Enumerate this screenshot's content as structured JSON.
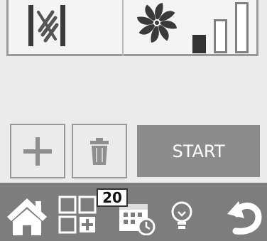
{
  "start_button": {
    "label": "START"
  },
  "schedule_badge": {
    "count": "20"
  },
  "fan_speed": {
    "levels": 3,
    "active_level": 1
  },
  "icons": {
    "filter": "filter-icon",
    "fan": "fan-icon",
    "add": "plus-icon",
    "delete": "trash-icon",
    "home": "home-icon",
    "scenes": "grid-icon",
    "schedule": "calendar-clock-icon",
    "light": "lightbulb-icon",
    "back": "back-arrow-icon"
  },
  "colors": {
    "background": "#ebebeb",
    "panel_border": "#9a9a9a",
    "start_button": "#8c8c8c",
    "nav_bar": "#7d7d7d"
  }
}
